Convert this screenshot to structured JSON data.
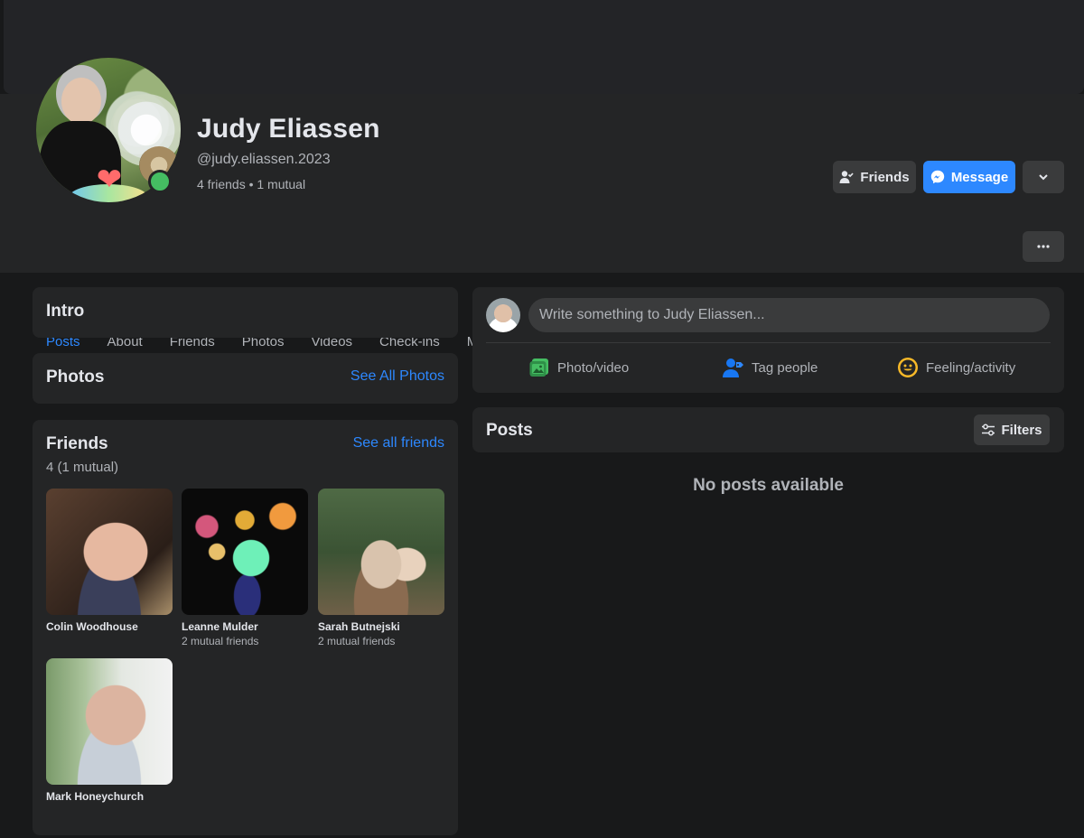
{
  "profile": {
    "name": "Judy Eliassen",
    "handle": "@judy.eliassen.2023",
    "meta": "4 friends • 1 mutual"
  },
  "actions": {
    "friends_label": "Friends",
    "message_label": "Message"
  },
  "tabs": [
    {
      "label": "Posts",
      "active": true
    },
    {
      "label": "About"
    },
    {
      "label": "Friends"
    },
    {
      "label": "Photos"
    },
    {
      "label": "Videos"
    },
    {
      "label": "Check-ins"
    },
    {
      "label": "More"
    }
  ],
  "intro": {
    "title": "Intro"
  },
  "photos": {
    "title": "Photos",
    "link": "See All Photos"
  },
  "friends": {
    "title": "Friends",
    "link": "See all friends",
    "count": "4 (1 mutual)",
    "items": [
      {
        "name": "Colin Woodhouse",
        "mutual": ""
      },
      {
        "name": "Leanne Mulder",
        "mutual": "2 mutual friends"
      },
      {
        "name": "Sarah Butnejski",
        "mutual": "2 mutual friends"
      },
      {
        "name": "Mark Honeychurch",
        "mutual": ""
      }
    ]
  },
  "composer": {
    "placeholder": "Write something to Judy Eliassen...",
    "photo_video": "Photo/video",
    "tag_people": "Tag people",
    "feeling": "Feeling/activity"
  },
  "posts": {
    "title": "Posts",
    "filters_label": "Filters",
    "empty": "No posts available"
  },
  "colors": {
    "background": "#18191a",
    "card": "#242526",
    "accent": "#2d88ff",
    "secondary_button": "#3a3b3c",
    "online": "#45bd62",
    "photo_icon": "#45bd62",
    "tag_icon": "#1877f2",
    "feeling_icon": "#f7b928"
  }
}
